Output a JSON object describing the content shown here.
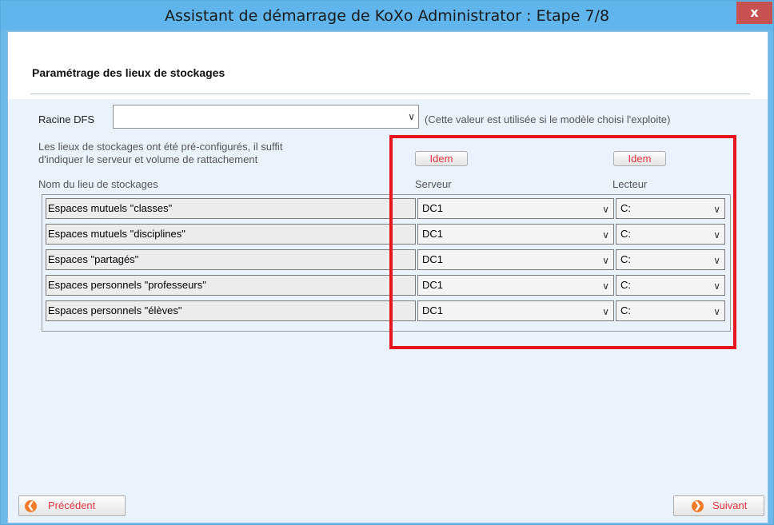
{
  "window": {
    "title": "Assistant de démarrage de KoXo Administrator : Etape 7/8",
    "close_label": "x"
  },
  "page": {
    "heading": "Paramétrage des lieux de stockages"
  },
  "dfs": {
    "label": "Racine DFS",
    "value": "",
    "note": "(Cette valeur est utilisée si le modèle choisi l'exploite)"
  },
  "info": {
    "line1": "Les lieux de stockages ont été pré-configurés, il suffit",
    "line2": "d'indiquer le serveur et volume de rattachement"
  },
  "buttons": {
    "idem_server": "Idem",
    "idem_drive": "Idem",
    "previous": "Précédent",
    "next": "Suivant"
  },
  "columns": {
    "name": "Nom du lieu  de stockages",
    "server": "Serveur",
    "drive": "Lecteur"
  },
  "rows": [
    {
      "name": "Espaces mutuels \"classes\"",
      "server": "DC1",
      "drive": "C:"
    },
    {
      "name": "Espaces mutuels \"disciplines\"",
      "server": "DC1",
      "drive": "C:"
    },
    {
      "name": "Espaces \"partagés\"",
      "server": "DC1",
      "drive": "C:"
    },
    {
      "name": "Espaces personnels \"professeurs\"",
      "server": "DC1",
      "drive": "C:"
    },
    {
      "name": "Espaces personnels \"élèves\"",
      "server": "DC1",
      "drive": "C:"
    }
  ],
  "icons": {
    "dropdown": "chevron-down-icon",
    "previous": "arrow-left-circle-icon",
    "next": "arrow-right-circle-icon"
  },
  "colors": {
    "titlebar": "#5fb5ec",
    "close": "#c75050",
    "accent_text": "#e2333d",
    "highlight": "#e8141c"
  }
}
